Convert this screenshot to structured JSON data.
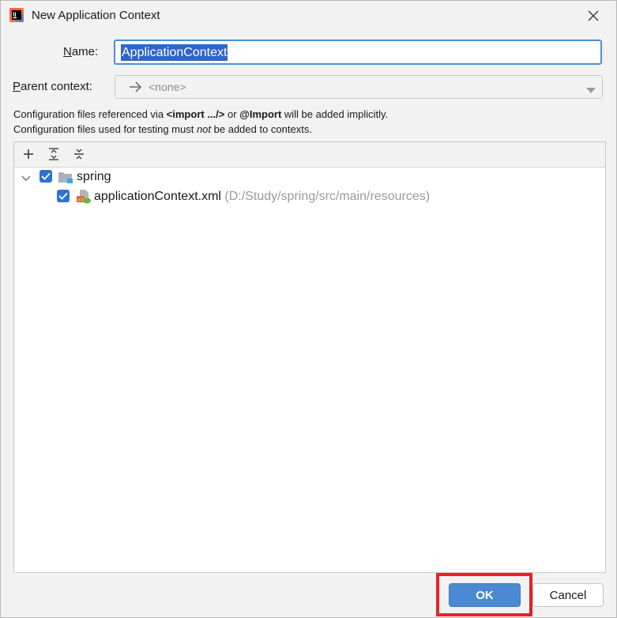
{
  "window": {
    "title": "New Application Context"
  },
  "form": {
    "name_label_mnemonic": "N",
    "name_label_rest": "ame:",
    "name_value": "ApplicationContext",
    "parent_label_mnemonic": "P",
    "parent_label_rest": "arent context:",
    "parent_value": "<none>"
  },
  "info": {
    "line1_a": "Configuration files referenced via ",
    "line1_b": "<import .../>",
    "line1_c": " or ",
    "line1_d": "@Import",
    "line1_e": " will be added implicitly.",
    "line2_a": "Configuration files used for testing must ",
    "line2_b": "not",
    "line2_c": " be added to contexts."
  },
  "tree": {
    "items": [
      {
        "label": "spring",
        "checked": true,
        "icon": "module-folder-icon"
      },
      {
        "label": "applicationContext.xml",
        "path": "(D:/Study/spring/src/main/resources)",
        "checked": true,
        "icon": "spring-xml-icon"
      }
    ]
  },
  "buttons": {
    "ok": "OK",
    "cancel": "Cancel"
  },
  "colors": {
    "accent": "#4b8ad2",
    "selection": "#2f65ca",
    "checkbox": "#2e72d2",
    "highlight": "#e8202a"
  }
}
